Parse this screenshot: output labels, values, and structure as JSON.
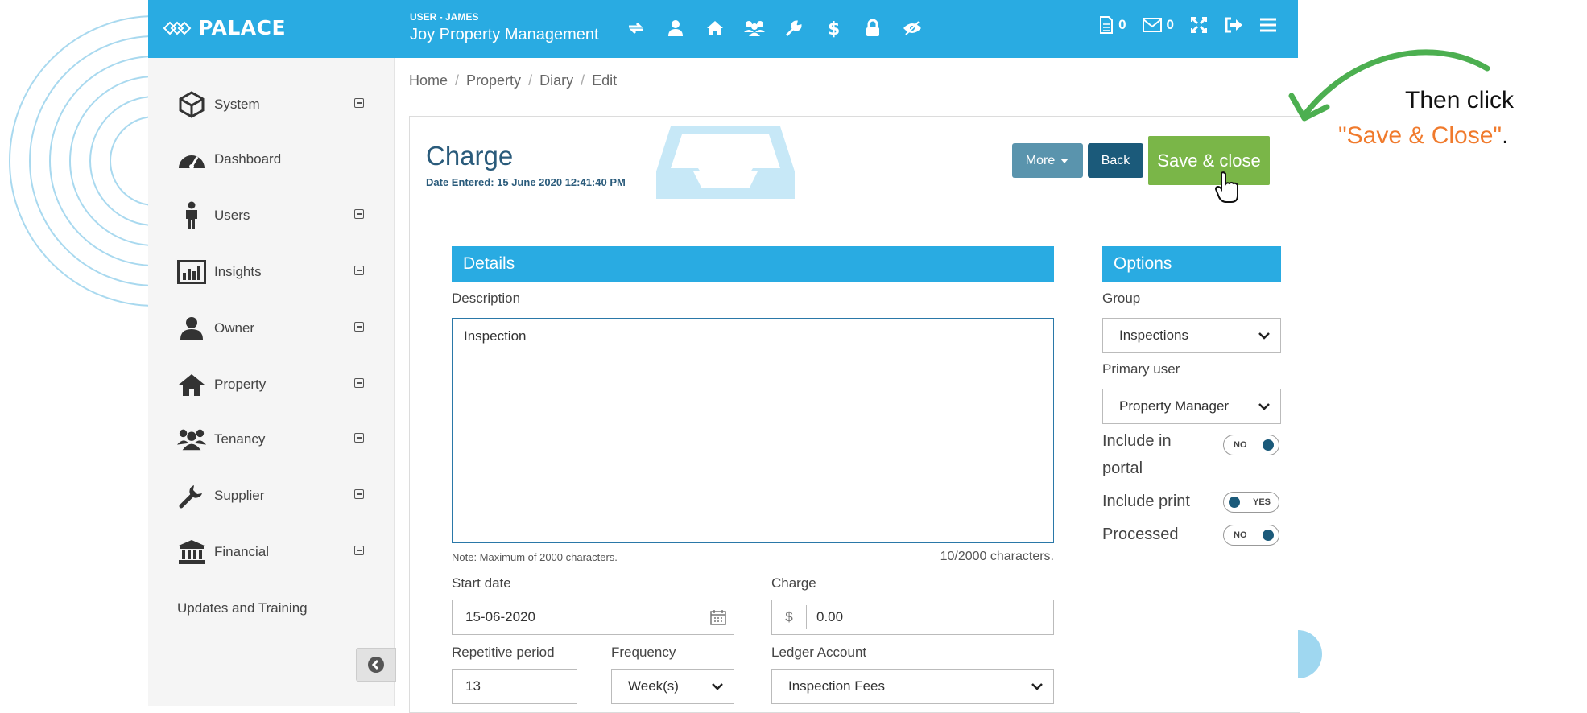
{
  "topbar": {
    "logo": "PALACE",
    "user_label": "USER - JAMES",
    "company": "Joy Property Management",
    "icons": [
      "sync-icon",
      "user-icon",
      "home-icon",
      "group-icon",
      "wrench-icon",
      "dollar-icon",
      "lock-icon",
      "eye-slash-icon"
    ],
    "documents_count": "0",
    "messages_count": "0"
  },
  "sidebar": {
    "items": [
      {
        "label": "System",
        "icon": "cube-icon"
      },
      {
        "label": "Dashboard",
        "icon": "dashboard-icon"
      },
      {
        "label": "Users",
        "icon": "user-male-icon"
      },
      {
        "label": "Insights",
        "icon": "bar-chart-icon"
      },
      {
        "label": "Owner",
        "icon": "user-icon"
      },
      {
        "label": "Property",
        "icon": "home-icon"
      },
      {
        "label": "Tenancy",
        "icon": "group-icon"
      },
      {
        "label": "Supplier",
        "icon": "wrench-icon"
      },
      {
        "label": "Financial",
        "icon": "bank-icon"
      }
    ],
    "updates": "Updates and Training"
  },
  "breadcrumb": [
    "Home",
    "Property",
    "Diary",
    "Edit"
  ],
  "page": {
    "title": "Charge",
    "date_entered": "Date Entered: 15 June 2020 12:41:40 PM",
    "buttons": {
      "more": "More",
      "back": "Back",
      "save": "Save & close"
    }
  },
  "details": {
    "header": "Details",
    "description_label": "Description",
    "description_value": "Inspection",
    "note": "Note: Maximum of 2000 characters.",
    "char_count": "10/2000 characters.",
    "start_date_label": "Start date",
    "start_date_value": "15-06-2020",
    "charge_label": "Charge",
    "charge_currency": "$",
    "charge_value": "0.00",
    "repetitive_label": "Repetitive period",
    "repetitive_value": "13",
    "frequency_label": "Frequency",
    "frequency_value": "Week(s)",
    "ledger_label": "Ledger Account",
    "ledger_value": "Inspection Fees"
  },
  "options": {
    "header": "Options",
    "group_label": "Group",
    "group_value": "Inspections",
    "primary_user_label": "Primary user",
    "primary_user_value": "Property Manager",
    "include_portal_label": "Include in portal",
    "include_portal_line1": "Include in",
    "include_portal_line2": "portal",
    "include_portal_value": "NO",
    "include_print_label": "Include print",
    "include_print_value": "YES",
    "processed_label": "Processed",
    "processed_value": "NO"
  },
  "annotation": {
    "line1": "Then click",
    "line2": "\"Save & Close\"",
    "period": ".",
    "arrow_color": "#4caf50",
    "accent_color": "#f07a2c"
  },
  "colors": {
    "topbar": "#29abe2",
    "save_button": "#7ab648",
    "back_button": "#1b5a7a",
    "more_button": "#5a94ad"
  }
}
